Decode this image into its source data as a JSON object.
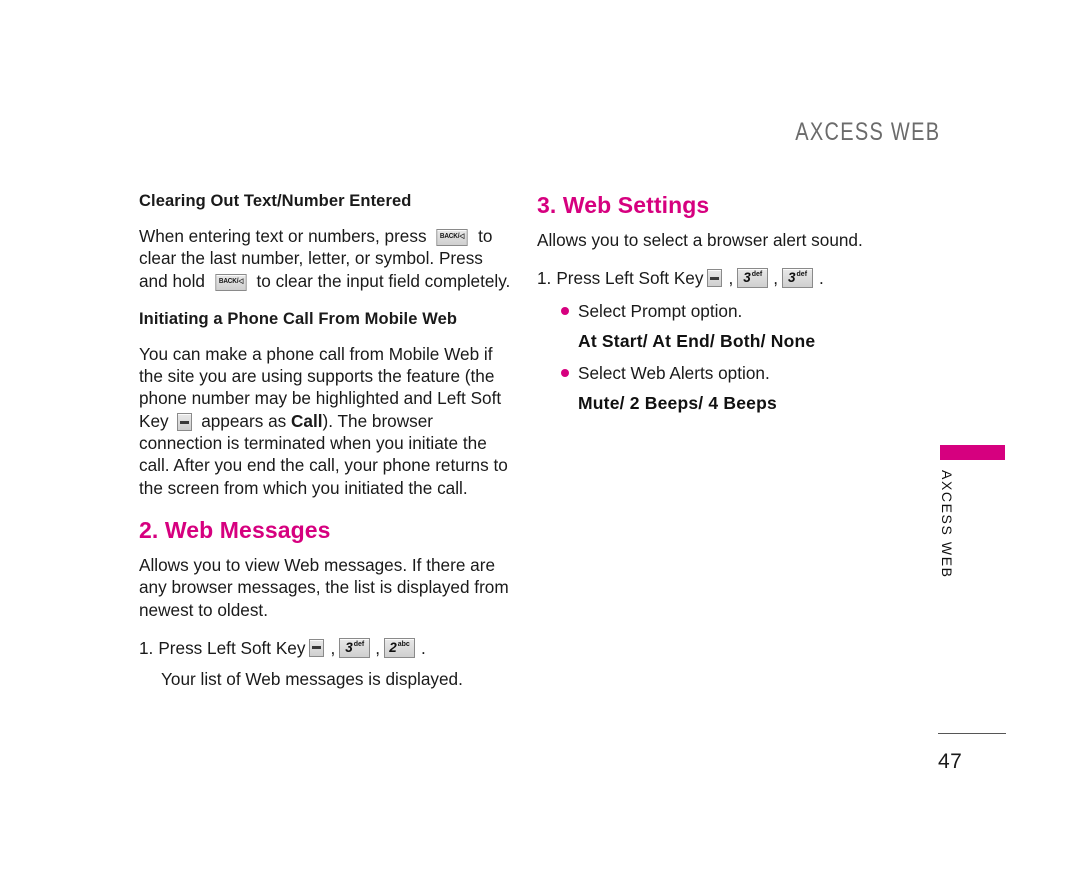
{
  "page": {
    "running_head": "AXCESS WEB",
    "page_number": "47",
    "edge_tab_label": "AXCESS WEB",
    "accent_color": "#d6007f",
    "head_color": "#6b6b6b"
  },
  "keys": {
    "back_clear": "BACK/◁",
    "back_clear_text": "BACK/",
    "soft_key_name": "left-soft-key",
    "three": {
      "digit": "3",
      "letters": "def"
    },
    "two": {
      "digit": "2",
      "letters": "abc"
    }
  },
  "left_column": {
    "clearing": {
      "heading": "Clearing Out Text/Number Entered",
      "text_part1": "When entering text or numbers, press",
      "text_part2": "to clear the last number, letter, or symbol. Press and hold",
      "text_part3": "to clear the input field completely."
    },
    "initiating": {
      "heading": "Initiating a Phone Call From Mobile Web",
      "text_part1": "You can make a phone call from Mobile Web if the site you are using supports the feature (the phone number may be highlighted and Left Soft Key",
      "text_part2": "appears as",
      "bold_word": "Call",
      "text_part3": "). The browser connection is terminated when you initiate the call. After you end the call, your phone returns to the screen from which you initiated the call."
    },
    "web_messages": {
      "heading": "2. Web Messages",
      "body": "Allows you to view Web messages. If there are any browser messages, the list is displayed from newest to oldest.",
      "step_number": "1.",
      "step_text": "Press Left Soft Key",
      "comma1": ",",
      "comma2": ",",
      "period": ".",
      "substep": "Your list of Web messages is displayed."
    }
  },
  "right_column": {
    "web_settings": {
      "heading": "3. Web Settings",
      "body": "Allows you to select a browser alert sound.",
      "step_number": "1.",
      "step_text": "Press Left Soft Key",
      "comma1": ",",
      "comma2": ",",
      "period": ".",
      "bullets": [
        {
          "text": "Select Prompt option.",
          "options": "At Start/ At End/ Both/ None"
        },
        {
          "text": "Select Web Alerts option.",
          "options": "Mute/ 2 Beeps/ 4 Beeps"
        }
      ]
    }
  }
}
